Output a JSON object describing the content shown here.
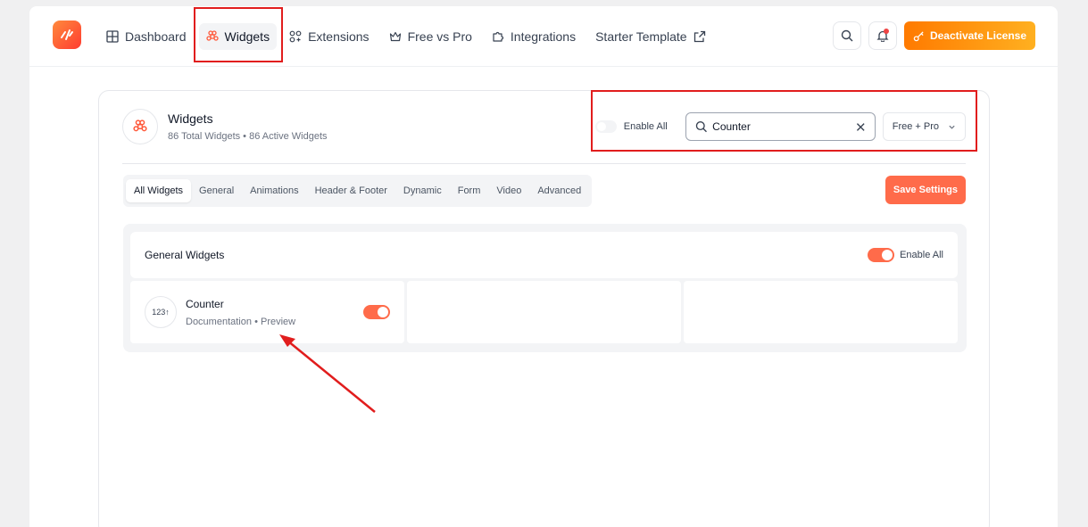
{
  "nav": {
    "items": [
      {
        "label": "Dashboard",
        "icon": "grid-icon"
      },
      {
        "label": "Widgets",
        "icon": "command-icon",
        "active": true
      },
      {
        "label": "Extensions",
        "icon": "extensions-icon"
      },
      {
        "label": "Free vs Pro",
        "icon": "crown-icon"
      },
      {
        "label": "Integrations",
        "icon": "puzzle-icon"
      },
      {
        "label": "Starter Template",
        "icon": "external-link-icon"
      }
    ]
  },
  "top_actions": {
    "license_label": "Deactivate License"
  },
  "header": {
    "title": "Widgets",
    "subtitle": "86 Total Widgets • 86 Active Widgets",
    "enable_all_label": "Enable All",
    "search_value": "Counter",
    "filter_value": "Free + Pro"
  },
  "tabs": [
    "All Widgets",
    "General",
    "Animations",
    "Header & Footer",
    "Dynamic",
    "Form",
    "Video",
    "Advanced"
  ],
  "save_label": "Save Settings",
  "panel": {
    "title": "General Widgets",
    "enable_all_label": "Enable All",
    "widgets": [
      {
        "icon_text": "123",
        "name": "Counter",
        "doc_label": "Documentation",
        "sep": "•",
        "preview_label": "Preview",
        "enabled": true
      }
    ]
  },
  "colors": {
    "accent": "#ff6b4a",
    "annotation": "#e11d1d",
    "license_gradient_start": "#ff7a00",
    "license_gradient_end": "#ffb020"
  }
}
